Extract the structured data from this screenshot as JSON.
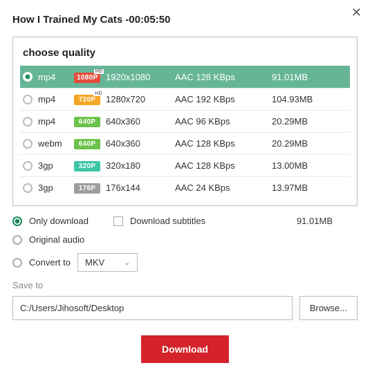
{
  "title": "How I Trained My Cats  -00:05:50",
  "quality_heading": "choose quality",
  "rows": [
    {
      "fmt": "mp4",
      "badge": "1080P",
      "res": "1920x1080",
      "audio": "AAC 128 KBps",
      "size": "91.01MB"
    },
    {
      "fmt": "mp4",
      "badge": "720P",
      "res": "1280x720",
      "audio": "AAC 192 KBps",
      "size": "104.93MB"
    },
    {
      "fmt": "mp4",
      "badge": "640P",
      "res": "640x360",
      "audio": "AAC 96 KBps",
      "size": "20.29MB"
    },
    {
      "fmt": "webm",
      "badge": "640P",
      "res": "640x360",
      "audio": "AAC 128 KBps",
      "size": "20.29MB"
    },
    {
      "fmt": "3gp",
      "badge": "320P",
      "res": "320x180",
      "audio": "AAC 128 KBps",
      "size": "13.00MB"
    },
    {
      "fmt": "3gp",
      "badge": "176P",
      "res": "176x144",
      "audio": "AAC 24 KBps",
      "size": "13.97MB"
    }
  ],
  "options": {
    "only_download": "Only download",
    "download_subtitles": "Download subtitles",
    "selected_size": "91.01MB",
    "original_audio": "Original audio",
    "convert_to": "Convert to",
    "convert_format": "MKV"
  },
  "save_to_label": "Save to",
  "save_path": "C:/Users/Jihosoft/Desktop",
  "browse_label": "Browse...",
  "download_label": "Download",
  "hd_label": "HD"
}
